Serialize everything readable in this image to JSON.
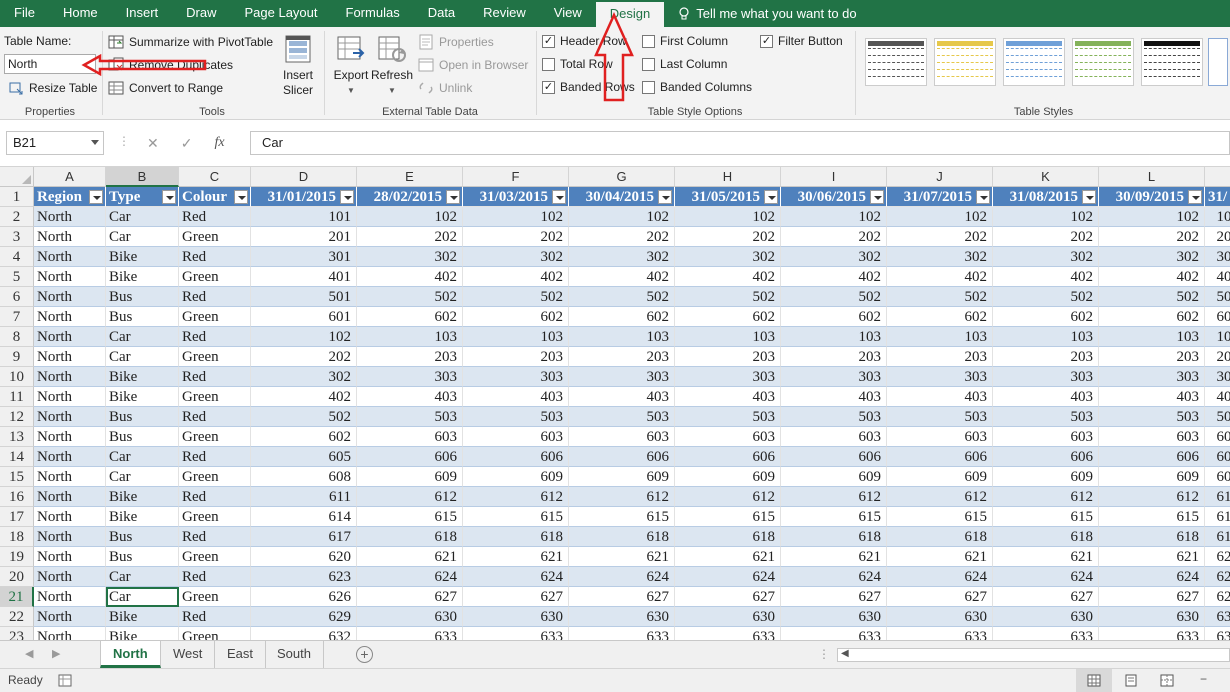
{
  "ribbon_tabs": [
    "File",
    "Home",
    "Insert",
    "Draw",
    "Page Layout",
    "Formulas",
    "Data",
    "Review",
    "View",
    "Design"
  ],
  "tell_me": "Tell me what you want to do",
  "properties": {
    "label": "Properties",
    "table_name_label": "Table Name:",
    "table_name_value": "North",
    "resize": "Resize Table"
  },
  "tools": {
    "label": "Tools",
    "summarize": "Summarize with PivotTable",
    "remove_dup": "Remove Duplicates",
    "convert": "Convert to Range",
    "insert_slicer_1": "Insert",
    "insert_slicer_2": "Slicer"
  },
  "external": {
    "label": "External Table Data",
    "export": "Export",
    "refresh": "Refresh",
    "props": "Properties",
    "open_browser": "Open in Browser",
    "unlink": "Unlink"
  },
  "style_options": {
    "label": "Table Style Options",
    "header_row": "Header Row",
    "total_row": "Total Row",
    "banded_rows": "Banded Rows",
    "first_col": "First Column",
    "last_col": "Last Column",
    "banded_cols": "Banded Columns",
    "filter_btn": "Filter Button",
    "checked": {
      "header_row": true,
      "total_row": false,
      "banded_rows": true,
      "first_col": false,
      "last_col": false,
      "banded_cols": false,
      "filter_btn": true
    }
  },
  "table_styles": {
    "label": "Table Styles",
    "swatch_colors": [
      "#555555",
      "#e6c84a",
      "#6fa0d8",
      "#84b35a",
      "#111111"
    ]
  },
  "name_box": "B21",
  "formula": "Car",
  "columns": [
    "A",
    "B",
    "C",
    "D",
    "E",
    "F",
    "G",
    "H",
    "I",
    "J",
    "K",
    "L"
  ],
  "header": [
    "Region",
    "Type",
    "Colour",
    "31/01/2015",
    "28/02/2015",
    "31/03/2015",
    "30/04/2015",
    "31/05/2015",
    "30/06/2015",
    "31/07/2015",
    "31/08/2015",
    "30/09/2015",
    "31/"
  ],
  "rows": [
    {
      "n": "2",
      "region": "North",
      "type": "Car",
      "colour": "Red",
      "d": "101",
      "v": "102"
    },
    {
      "n": "3",
      "region": "North",
      "type": "Car",
      "colour": "Green",
      "d": "201",
      "v": "202"
    },
    {
      "n": "4",
      "region": "North",
      "type": "Bike",
      "colour": "Red",
      "d": "301",
      "v": "302"
    },
    {
      "n": "5",
      "region": "North",
      "type": "Bike",
      "colour": "Green",
      "d": "401",
      "v": "402"
    },
    {
      "n": "6",
      "region": "North",
      "type": "Bus",
      "colour": "Red",
      "d": "501",
      "v": "502"
    },
    {
      "n": "7",
      "region": "North",
      "type": "Bus",
      "colour": "Green",
      "d": "601",
      "v": "602"
    },
    {
      "n": "8",
      "region": "North",
      "type": "Car",
      "colour": "Red",
      "d": "102",
      "v": "103"
    },
    {
      "n": "9",
      "region": "North",
      "type": "Car",
      "colour": "Green",
      "d": "202",
      "v": "203"
    },
    {
      "n": "10",
      "region": "North",
      "type": "Bike",
      "colour": "Red",
      "d": "302",
      "v": "303"
    },
    {
      "n": "11",
      "region": "North",
      "type": "Bike",
      "colour": "Green",
      "d": "402",
      "v": "403"
    },
    {
      "n": "12",
      "region": "North",
      "type": "Bus",
      "colour": "Red",
      "d": "502",
      "v": "503"
    },
    {
      "n": "13",
      "region": "North",
      "type": "Bus",
      "colour": "Green",
      "d": "602",
      "v": "603"
    },
    {
      "n": "14",
      "region": "North",
      "type": "Car",
      "colour": "Red",
      "d": "605",
      "v": "606"
    },
    {
      "n": "15",
      "region": "North",
      "type": "Car",
      "colour": "Green",
      "d": "608",
      "v": "609"
    },
    {
      "n": "16",
      "region": "North",
      "type": "Bike",
      "colour": "Red",
      "d": "611",
      "v": "612"
    },
    {
      "n": "17",
      "region": "North",
      "type": "Bike",
      "colour": "Green",
      "d": "614",
      "v": "615"
    },
    {
      "n": "18",
      "region": "North",
      "type": "Bus",
      "colour": "Red",
      "d": "617",
      "v": "618"
    },
    {
      "n": "19",
      "region": "North",
      "type": "Bus",
      "colour": "Green",
      "d": "620",
      "v": "621"
    },
    {
      "n": "20",
      "region": "North",
      "type": "Car",
      "colour": "Red",
      "d": "623",
      "v": "624"
    },
    {
      "n": "21",
      "region": "North",
      "type": "Car",
      "colour": "Green",
      "d": "626",
      "v": "627"
    },
    {
      "n": "22",
      "region": "North",
      "type": "Bike",
      "colour": "Red",
      "d": "629",
      "v": "630"
    },
    {
      "n": "23",
      "region": "North",
      "type": "Bike",
      "colour": "Green",
      "d": "632",
      "v": "633"
    }
  ],
  "sheets": [
    "North",
    "West",
    "East",
    "South"
  ],
  "status": "Ready",
  "colors": {
    "accent": "#217346",
    "table_header": "#4f81bd",
    "band": "#dce6f1",
    "annotation": "#e02020"
  }
}
